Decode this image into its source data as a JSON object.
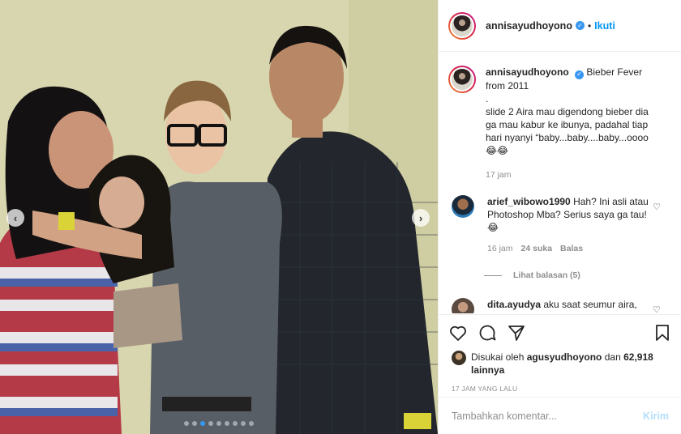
{
  "post": {
    "author": "annisayudhoyono",
    "follow_label": "Ikuti",
    "follow_separator": "•",
    "caption": "Bieber Fever from 2011\n.\nslide 2 Aira mau digendong bieber dia ga mau kabur ke ibunya, padahal tiap hari nyanyi “baby...baby....baby...oooo 😂😂",
    "caption_time": "17 jam"
  },
  "comments": [
    {
      "user": "arief_wibowo1990",
      "text": "Hah? Ini asli atau Photoshop Mba? Serius saya ga tau!😂",
      "time": "16 jam",
      "likes": "24 suka",
      "reply_label": "Balas",
      "view_replies": "Lihat balasan (5)"
    },
    {
      "user": "dita.ayudya",
      "text": "aku saat seumur aira,"
    }
  ],
  "engagement": {
    "liked_by_prefix": "Disukai oleh",
    "liked_by_user": "agusyudhoyono",
    "liked_by_and": "dan",
    "others_count": "62,918 lainnya",
    "timestamp": "17 JAM YANG LALU"
  },
  "composer": {
    "placeholder": "Tambahkan komentar...",
    "send_label": "Kirim"
  },
  "carousel": {
    "slide_count": 9,
    "active_slide": 3
  },
  "colors": {
    "accent": "#0095f6",
    "verified": "#3897f0",
    "muted": "#8e8e8e"
  },
  "icons": [
    "verified-icon",
    "heart-icon",
    "comment-icon",
    "share-icon",
    "bookmark-icon",
    "chevron-left-icon",
    "chevron-right-icon",
    "smile-icon"
  ]
}
